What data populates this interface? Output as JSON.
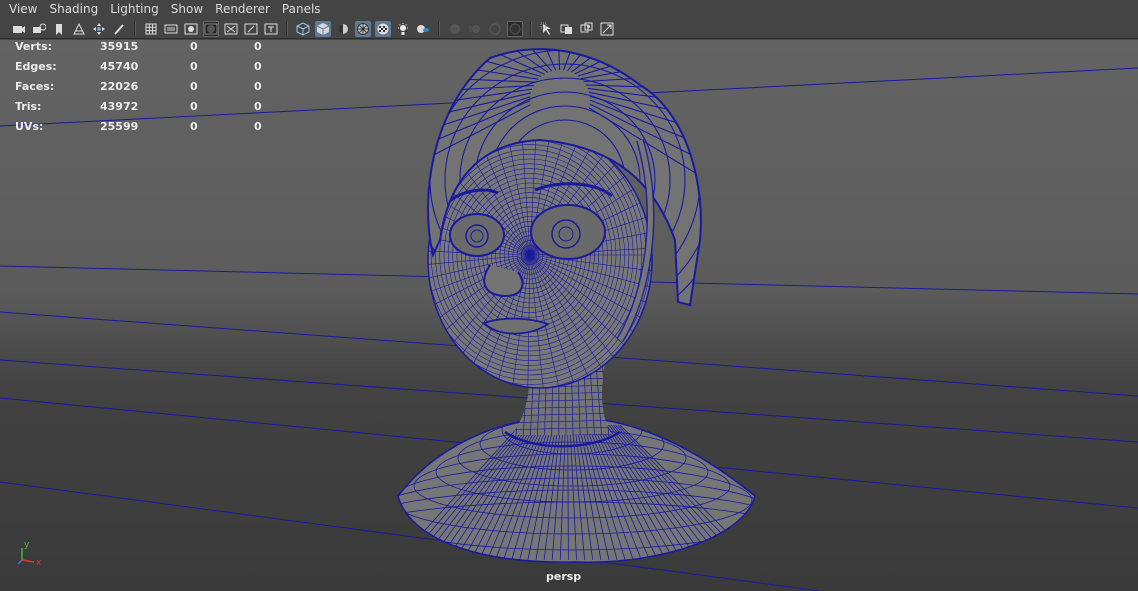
{
  "menu": [
    "View",
    "Shading",
    "Lighting",
    "Show",
    "Renderer",
    "Panels"
  ],
  "toolbar": {
    "icons": [
      "camera-select-icon",
      "camera-attributes-icon",
      "bookmark-icon",
      "image-plane-icon",
      "2d-pan-zoom-icon",
      "grease-pencil-icon",
      "grid-icon",
      "film-gate-icon",
      "resolution-gate-icon",
      "gate-mask-icon",
      "field-chart-icon",
      "safe-action-icon",
      "safe-title-icon",
      "wireframe-icon",
      "smooth-shade-icon",
      "default-material-icon",
      "wireframe-on-shaded-icon",
      "textured-icon",
      "use-all-lights-icon",
      "shadows-icon",
      "ambient-occlusion-icon",
      "motion-blur-icon",
      "anti-aliasing-icon",
      "depth-of-field-icon",
      "isolate-select-icon",
      "xray-icon",
      "xray-joints-icon",
      "backface-culling-icon"
    ],
    "active": [
      "smooth-shade-icon",
      "wireframe-on-shaded-icon",
      "textured-icon"
    ]
  },
  "hud": {
    "rows": [
      {
        "label": "Verts:",
        "value": "35915",
        "c2": "0",
        "c3": "0"
      },
      {
        "label": "Edges:",
        "value": "45740",
        "c2": "0",
        "c3": "0"
      },
      {
        "label": "Faces:",
        "value": "22026",
        "c2": "0",
        "c3": "0"
      },
      {
        "label": "Tris:",
        "value": "43972",
        "c2": "0",
        "c3": "0"
      },
      {
        "label": "UVs:",
        "value": "25599",
        "c2": "0",
        "c3": "0"
      }
    ]
  },
  "camera_label": "persp",
  "axis": {
    "y": "y",
    "x": "x"
  },
  "colors": {
    "wire": "#1a1aa0",
    "mesh": "#767676",
    "active_button": "#5d7b98",
    "panel": "#444444"
  }
}
